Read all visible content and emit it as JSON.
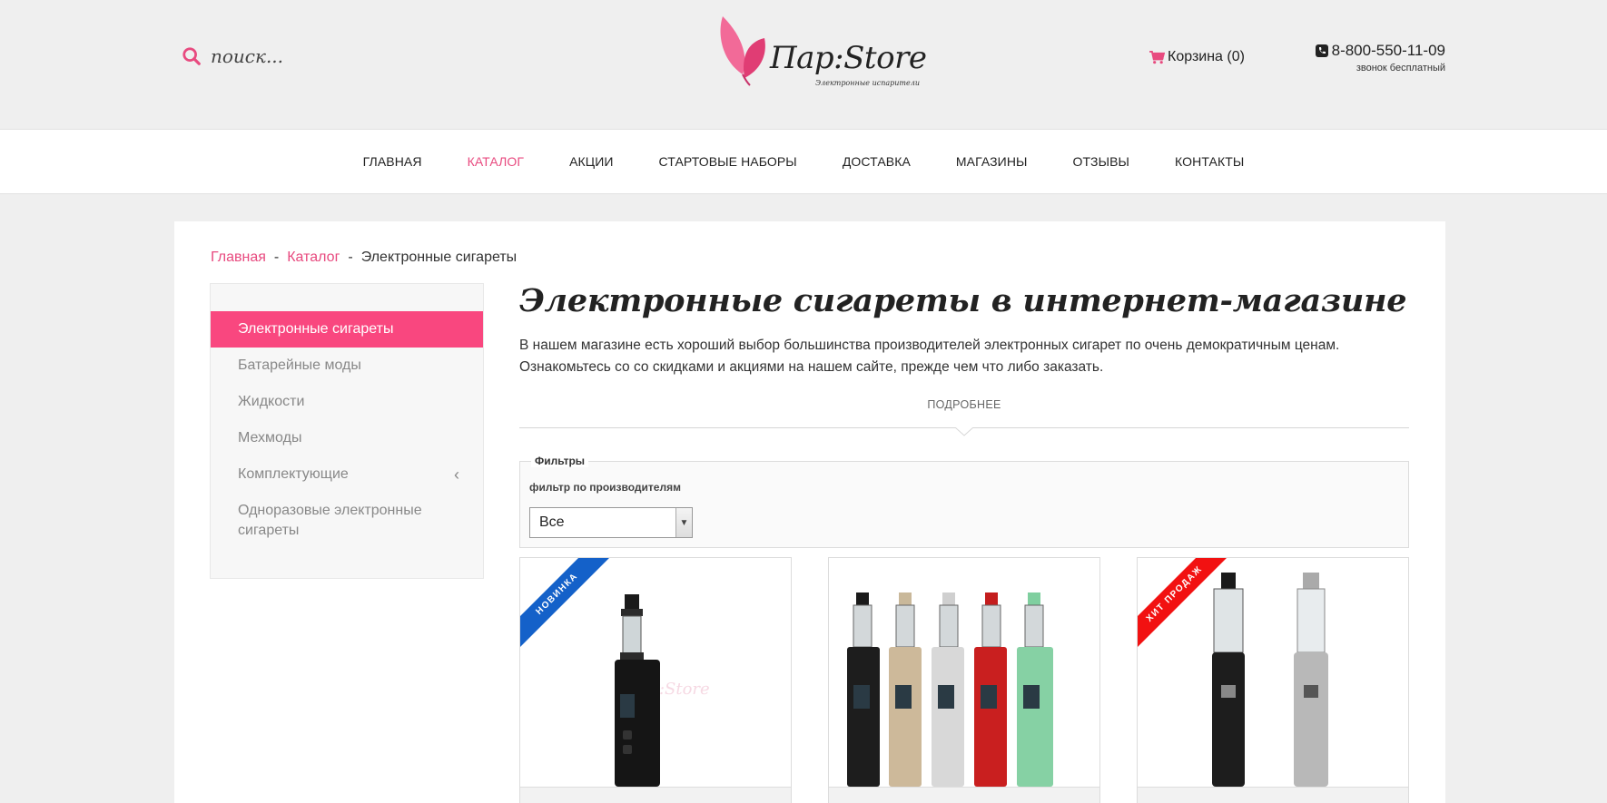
{
  "header": {
    "search_placeholder": "поиск...",
    "logo_text": "Пар:Store",
    "logo_subtitle": "Электронные испарители",
    "cart_label": "Корзина (0)",
    "phone": "8-800-550-11-09",
    "phone_note": "звонок бесплатный"
  },
  "nav": {
    "items": [
      {
        "label": "ГЛАВНАЯ"
      },
      {
        "label": "КАТАЛОГ",
        "active": true
      },
      {
        "label": "АКЦИИ"
      },
      {
        "label": "СТАРТОВЫЕ НАБОРЫ"
      },
      {
        "label": "ДОСТАВКА"
      },
      {
        "label": "МАГАЗИНЫ"
      },
      {
        "label": "ОТЗЫВЫ"
      },
      {
        "label": "КОНТАКТЫ"
      }
    ]
  },
  "breadcrumb": {
    "home": "Главная",
    "catalog": "Каталог",
    "current": "Электронные сигареты",
    "separator": "-"
  },
  "sidebar": {
    "items": [
      {
        "label": "Электронные сигареты",
        "active": true
      },
      {
        "label": "Батарейные моды"
      },
      {
        "label": "Жидкости"
      },
      {
        "label": "Мехмоды"
      },
      {
        "label": "Комплектующие",
        "chevron": "‹"
      },
      {
        "label": "Одноразовые электронные сигареты"
      }
    ]
  },
  "content": {
    "title": "Электронные сигареты в интернет-магазине",
    "intro": "В нашем магазине есть хороший выбор большинства производителей электронных сигарет по очень демократичным ценам. Ознакомьтесь со со скидками и акциями на нашем сайте, прежде чем что либо заказать.",
    "more_label": "ПОДРОБНЕЕ"
  },
  "filters": {
    "legend": "Фильтры",
    "label": "фильтр по производителям",
    "selected": "Все"
  },
  "products": [
    {
      "badge": "НОВИНКА",
      "badge_color": "#1461c9"
    },
    {
      "badge": ""
    },
    {
      "badge": "ХИТ ПРОДАЖ",
      "badge_color": "#f21111"
    }
  ],
  "colors": {
    "accent": "#e84a7f",
    "sidebar_active": "#f9477f",
    "background": "#efefef"
  }
}
